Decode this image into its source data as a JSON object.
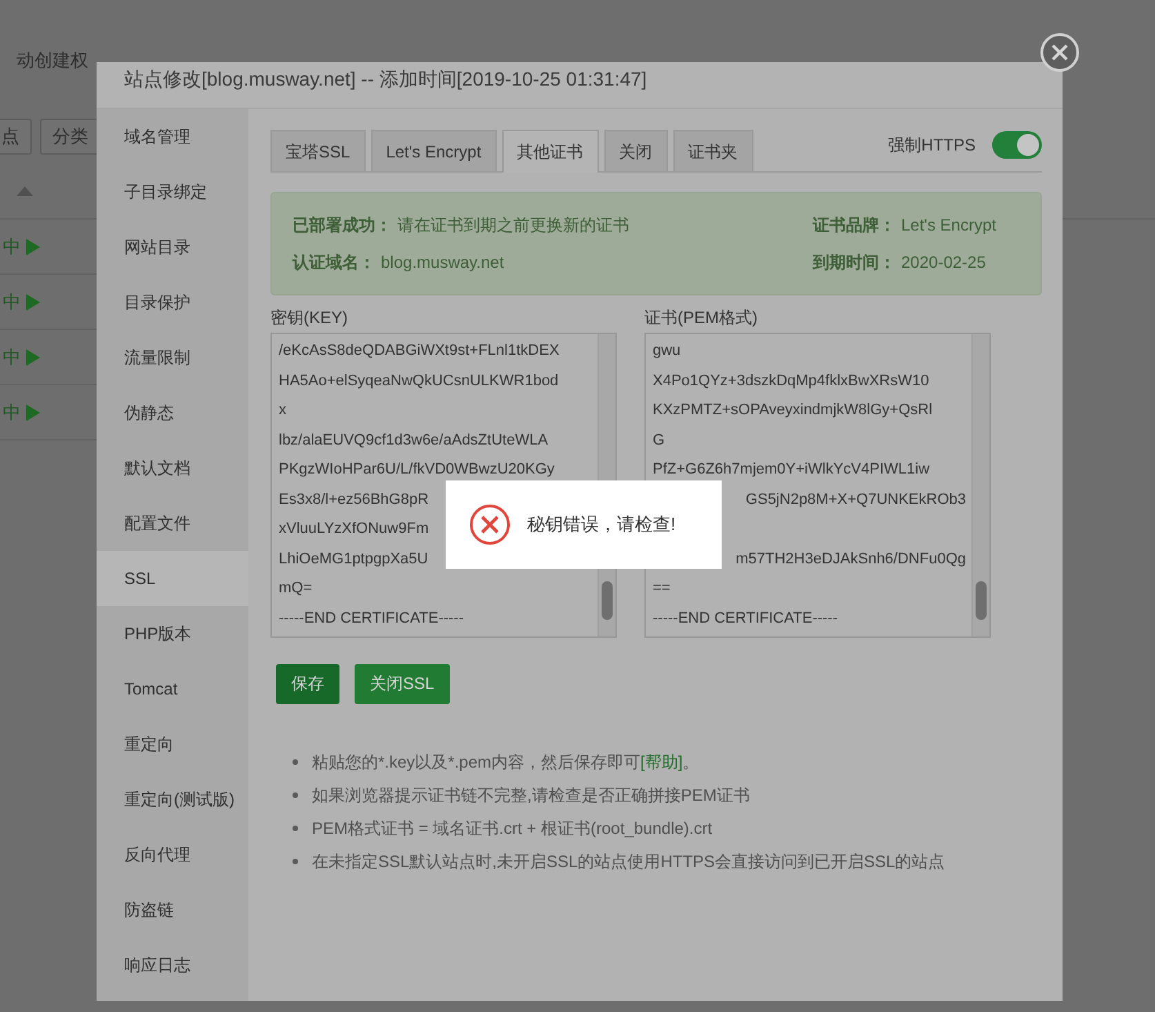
{
  "background": {
    "notice": "动创建权",
    "buttons": [
      "点",
      "分类"
    ],
    "rows": [
      {
        "status": "中"
      },
      {
        "status": "中"
      },
      {
        "status": "中"
      },
      {
        "status": "中"
      }
    ]
  },
  "dialog": {
    "title": "站点修改[blog.musway.net] -- 添加时间[2019-10-25 01:31:47]",
    "sidebar": [
      {
        "label": "域名管理",
        "selected": false
      },
      {
        "label": "子目录绑定",
        "selected": false
      },
      {
        "label": "网站目录",
        "selected": false
      },
      {
        "label": "目录保护",
        "selected": false
      },
      {
        "label": "流量限制",
        "selected": false
      },
      {
        "label": "伪静态",
        "selected": false
      },
      {
        "label": "默认文档",
        "selected": false
      },
      {
        "label": "配置文件",
        "selected": false
      },
      {
        "label": "SSL",
        "selected": true
      },
      {
        "label": "PHP版本",
        "selected": false
      },
      {
        "label": "Tomcat",
        "selected": false
      },
      {
        "label": "重定向",
        "selected": false
      },
      {
        "label": "重定向(测试版)",
        "selected": false
      },
      {
        "label": "反向代理",
        "selected": false
      },
      {
        "label": "防盗链",
        "selected": false
      },
      {
        "label": "响应日志",
        "selected": false
      }
    ],
    "tabs": [
      {
        "label": "宝塔SSL",
        "selected": false
      },
      {
        "label": "Let's Encrypt",
        "selected": false
      },
      {
        "label": "其他证书",
        "selected": true
      },
      {
        "label": "关闭",
        "selected": false
      },
      {
        "label": "证书夹",
        "selected": false
      }
    ],
    "force_https": {
      "label": "强制HTTPS",
      "on": true
    },
    "status_box": [
      {
        "label": "已部署成功：",
        "value": "请在证书到期之前更换新的证书"
      },
      {
        "label": "证书品牌：",
        "value": "Let's Encrypt"
      },
      {
        "label": "认证域名：",
        "value": "blog.musway.net"
      },
      {
        "label": "到期时间：",
        "value": "2020-02-25"
      }
    ],
    "key_field": {
      "label": "密钥(KEY)",
      "lines": [
        {
          "left": "/eKcAsS8deQDABGiWXt9st+FLnl1tkDEX"
        },
        {
          "left": "HA5Ao+elSyqeaNwQkUCsnULKWR1bod"
        },
        {
          "left": "x"
        },
        {
          "left": "lbz/alaEUVQ9cf1d3w6e/aAdsZtUteWLA"
        },
        {
          "left": "PKgzWIoHPar6U/L/fkVD0WBwzU20KGy"
        },
        {
          "left": "Es3x8/l+ez56BhG8pR"
        },
        {
          "left": "xVluuLYzXfONuw9Fm"
        },
        {
          "left": "LhiOeMG1ptpgpXa5U"
        },
        {
          "left": "mQ="
        },
        {
          "left": "-----END CERTIFICATE-----"
        }
      ]
    },
    "cert_field": {
      "label": "证书(PEM格式)",
      "lines": [
        {
          "left": "gwu"
        },
        {
          "left": "X4Po1QYz+3dszkDqMp4fklxBwXRsW10"
        },
        {
          "left": "KXzPMTZ+sOPAveyxindmjkW8lGy+QsRl"
        },
        {
          "left": "G"
        },
        {
          "left": "PfZ+G6Z6h7mjem0Y+iWlkYcV4PIWL1iw"
        },
        {
          "right": "GS5jN2p8M+X+Q7UNKEkROb3"
        },
        {
          "covered": true
        },
        {
          "right": "m57TH2H3eDJAkSnh6/DNFu0Qg"
        },
        {
          "left": "=="
        },
        {
          "left": "-----END CERTIFICATE-----"
        }
      ]
    },
    "buttons": [
      {
        "label": "保存"
      },
      {
        "label": "关闭SSL"
      }
    ],
    "notes": [
      {
        "text": "粘贴您的*.key以及*.pem内容，然后保存即可",
        "link": "[帮助]",
        "after": "。"
      },
      {
        "text": "如果浏览器提示证书链不完整,请检查是否正确拼接PEM证书"
      },
      {
        "text": "PEM格式证书 = 域名证书.crt + 根证书(root_bundle).crt"
      },
      {
        "text": "在未指定SSL默认站点时,未开启SSL的站点使用HTTPS会直接访问到已开启SSL的站点"
      }
    ]
  },
  "toast": {
    "message": "秘钥错误，请检查!"
  }
}
